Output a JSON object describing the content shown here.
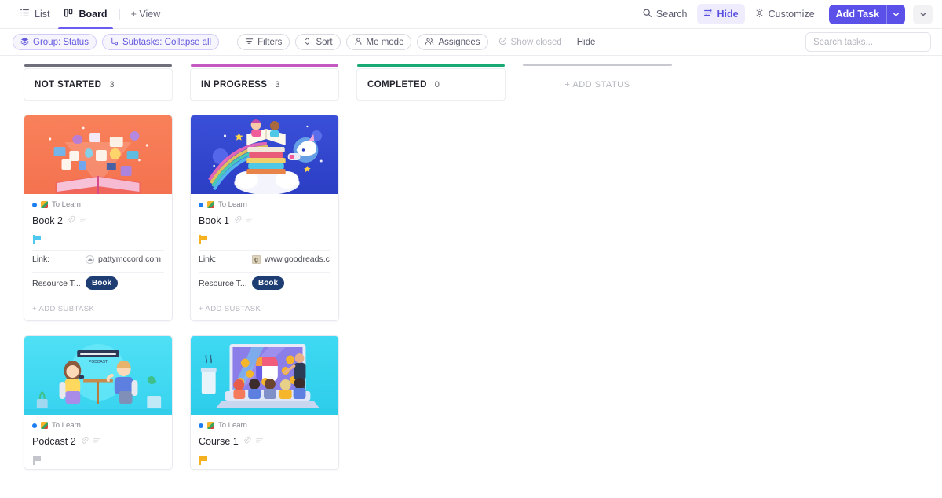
{
  "topbar": {
    "views": [
      {
        "label": "List",
        "icon": "list-icon",
        "active": false
      },
      {
        "label": "Board",
        "icon": "board-icon",
        "active": true
      }
    ],
    "add_view_label": "+ View",
    "actions": [
      {
        "label": "Search",
        "icon": "search-icon",
        "highlight": false
      },
      {
        "label": "Hide",
        "icon": "sliders-icon",
        "highlight": true
      },
      {
        "label": "Customize",
        "icon": "gear-icon",
        "highlight": false
      }
    ],
    "add_task": {
      "label": "Add Task",
      "caret": "chevron-down-icon"
    },
    "overflow_caret": "chevron-down-icon",
    "accent_color": "#5b51e8",
    "highlight_color": "#5b51e0"
  },
  "filterbar": {
    "chips": [
      {
        "label": "Group: Status",
        "icon": "layers-icon",
        "style": "purple"
      },
      {
        "label": "Subtasks: Collapse all",
        "icon": "subtask-icon",
        "style": "purple"
      },
      {
        "label": "Filters",
        "icon": "filter-icon",
        "style": "outline"
      },
      {
        "label": "Sort",
        "icon": "sort-icon",
        "style": "outline"
      },
      {
        "label": "Me mode",
        "icon": "person-icon",
        "style": "outline"
      },
      {
        "label": "Assignees",
        "icon": "people-icon",
        "style": "outline"
      },
      {
        "label": "Show closed",
        "icon": "check-circle-icon",
        "style": "muted"
      },
      {
        "label": "Hide",
        "icon": "none",
        "style": "plain"
      }
    ],
    "search": {
      "placeholder": "Search tasks...",
      "value": ""
    }
  },
  "board": {
    "columns": [
      {
        "title": "NOT STARTED",
        "count": "3",
        "accent": "#6d6f7a",
        "ghost": false
      },
      {
        "title": "IN PROGRESS",
        "count": "3",
        "accent": "#c459c4",
        "ghost": false
      },
      {
        "title": "COMPLETED",
        "count": "0",
        "accent": "#19a974",
        "ghost": false
      },
      {
        "title": "+ ADD STATUS",
        "count": "",
        "accent": "#c8c9d0",
        "ghost": true
      }
    ],
    "cards": [
      {
        "column": 0,
        "list_name": "To Learn",
        "title": "Book 2",
        "flag_color": "#4ec8ee",
        "cover": "orange-open-book",
        "fields": [
          {
            "label": "Link:",
            "value": "pattymccord.com",
            "favicon": "globe-icon"
          },
          {
            "label": "Resource T...",
            "value": "Book",
            "tag": true
          }
        ],
        "add_subtask_label": "+ ADD SUBTASK"
      },
      {
        "column": 1,
        "list_name": "To Learn",
        "title": "Book 1",
        "flag_color": "#f5b120",
        "cover": "blue-space-books",
        "fields": [
          {
            "label": "Link:",
            "value": "www.goodreads.con",
            "favicon": "goodreads-icon"
          },
          {
            "label": "Resource T...",
            "value": "Book",
            "tag": true
          }
        ],
        "add_subtask_label": "+ ADD SUBTASK"
      },
      {
        "column": 0,
        "list_name": "To Learn",
        "title": "Podcast 2",
        "flag_color": "#c3c4cc",
        "cover": "cyan-podcast",
        "fields": [],
        "add_subtask_label": ""
      },
      {
        "column": 1,
        "list_name": "To Learn",
        "title": "Course 1",
        "flag_color": "#f5b120",
        "cover": "cyan-online-course",
        "fields": [],
        "add_subtask_label": ""
      }
    ]
  }
}
